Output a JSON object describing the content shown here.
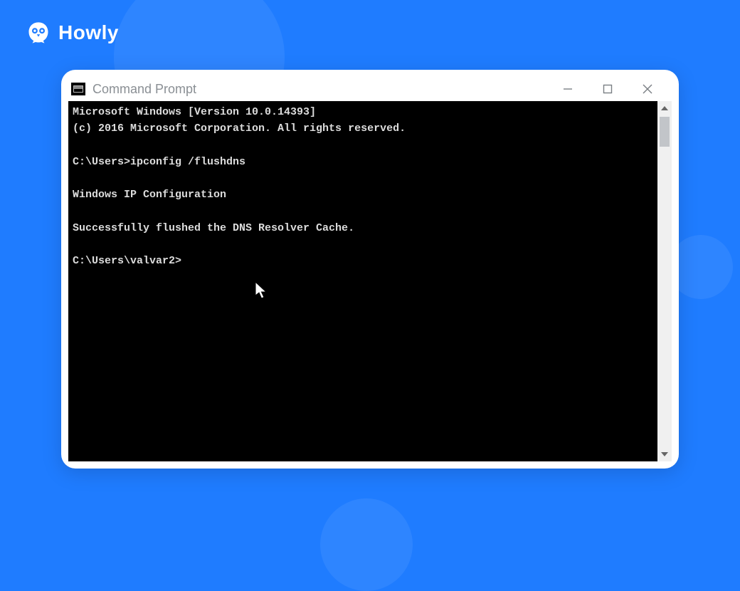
{
  "brand": {
    "name": "Howly"
  },
  "window": {
    "title": "Command Prompt"
  },
  "terminal": {
    "lines": [
      "Microsoft Windows [Version 10.0.14393]",
      "(c) 2016 Microsoft Corporation. All rights reserved.",
      "",
      "C:\\Users>ipconfig /flushdns",
      "",
      "Windows IP Configuration",
      "",
      "Successfully flushed the DNS Resolver Cache.",
      "",
      "C:\\Users\\valvar2>"
    ]
  }
}
